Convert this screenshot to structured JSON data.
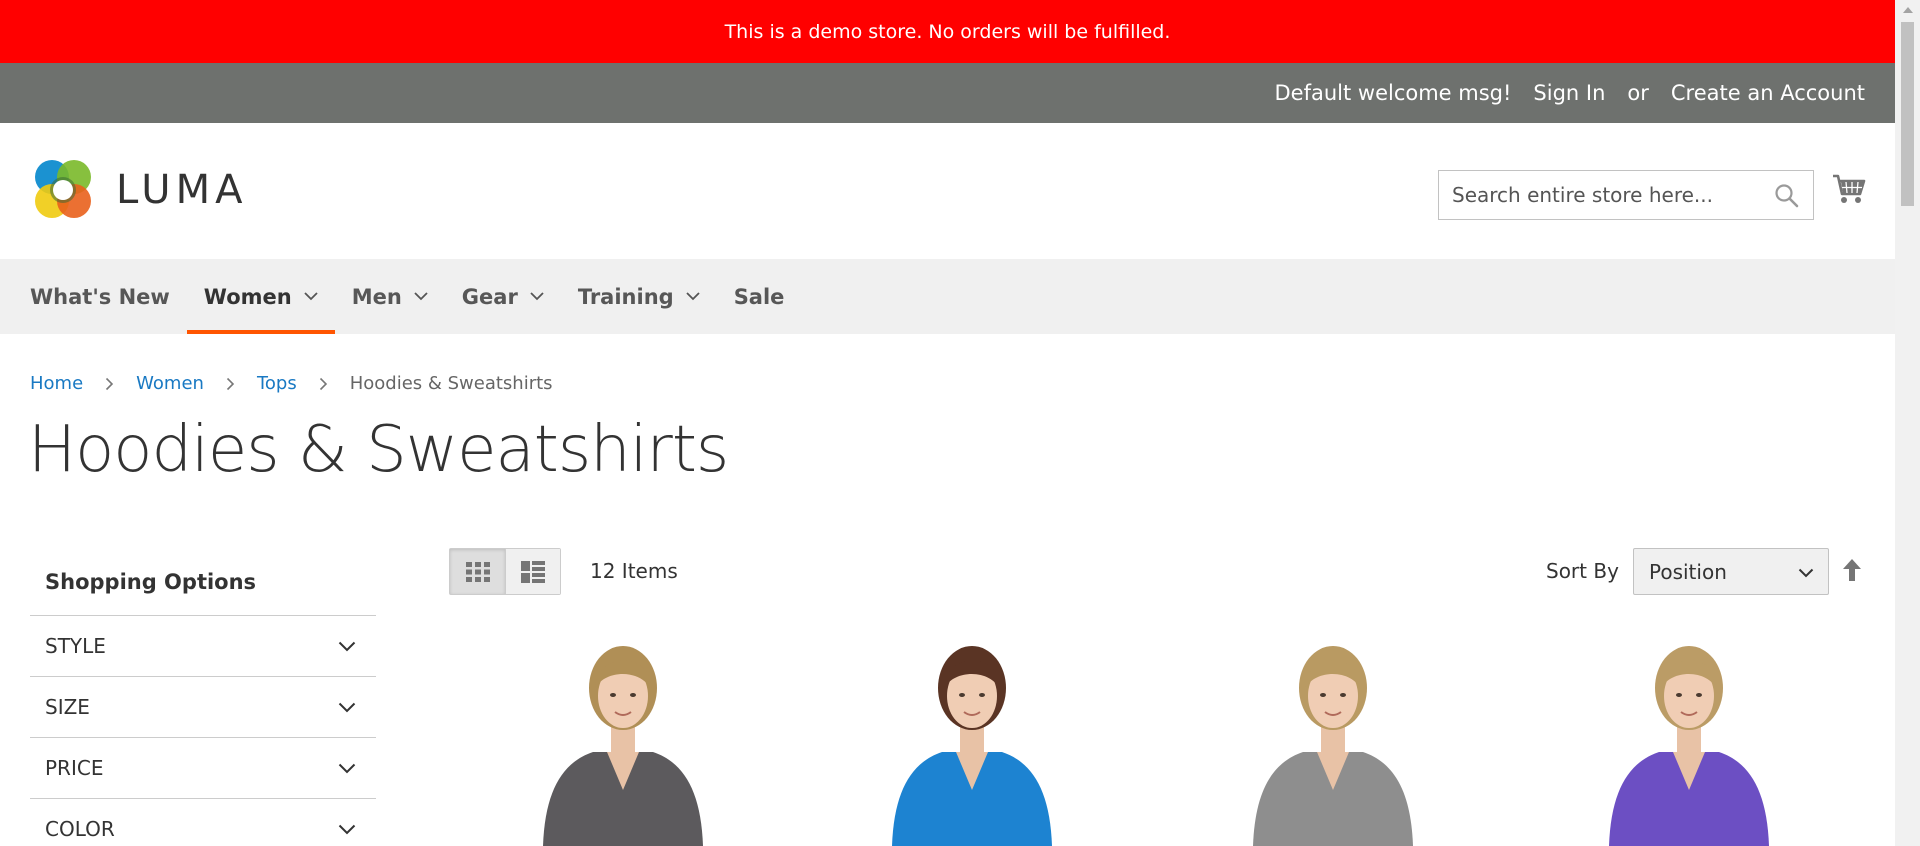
{
  "notice": {
    "text": "This is a demo store. No orders will be fulfilled."
  },
  "header_links": {
    "welcome": "Default welcome msg!",
    "sign_in": "Sign In",
    "or": "or",
    "create_account": "Create an Account"
  },
  "logo": {
    "text": "LUMA"
  },
  "search": {
    "placeholder": "Search entire store here..."
  },
  "nav": {
    "items": [
      {
        "label": "What's New",
        "has_dropdown": false
      },
      {
        "label": "Women",
        "has_dropdown": true,
        "active": true
      },
      {
        "label": "Men",
        "has_dropdown": true
      },
      {
        "label": "Gear",
        "has_dropdown": true
      },
      {
        "label": "Training",
        "has_dropdown": true
      },
      {
        "label": "Sale",
        "has_dropdown": false
      }
    ]
  },
  "breadcrumbs": {
    "items": [
      "Home",
      "Women",
      "Tops"
    ],
    "current": "Hoodies & Sweatshirts"
  },
  "page_title": "Hoodies & Sweatshirts",
  "sidebar": {
    "title": "Shopping Options",
    "filters": [
      "STYLE",
      "SIZE",
      "PRICE",
      "COLOR"
    ]
  },
  "toolbar": {
    "view_modes": [
      "grid-icon",
      "list-icon"
    ],
    "active_mode": "grid",
    "amount": "12 Items",
    "sort_label": "Sort By",
    "sort_value": "Position"
  },
  "colors": {
    "notice_bg": "#ff0000",
    "panel_bg": "#6e716e",
    "nav_bg": "#f0f0f0",
    "nav_active_underline": "#ff5501",
    "link": "#1979c3"
  },
  "products": [
    {
      "shirt_color": "#5c5a5d",
      "hair": "#b08f56"
    },
    {
      "shirt_color": "#1d83d1",
      "hair": "#5a3424"
    },
    {
      "shirt_color": "#8e8e8e",
      "hair": "#b99a62"
    },
    {
      "shirt_color": "#6c4fc3",
      "hair": "#bb9c66"
    }
  ]
}
